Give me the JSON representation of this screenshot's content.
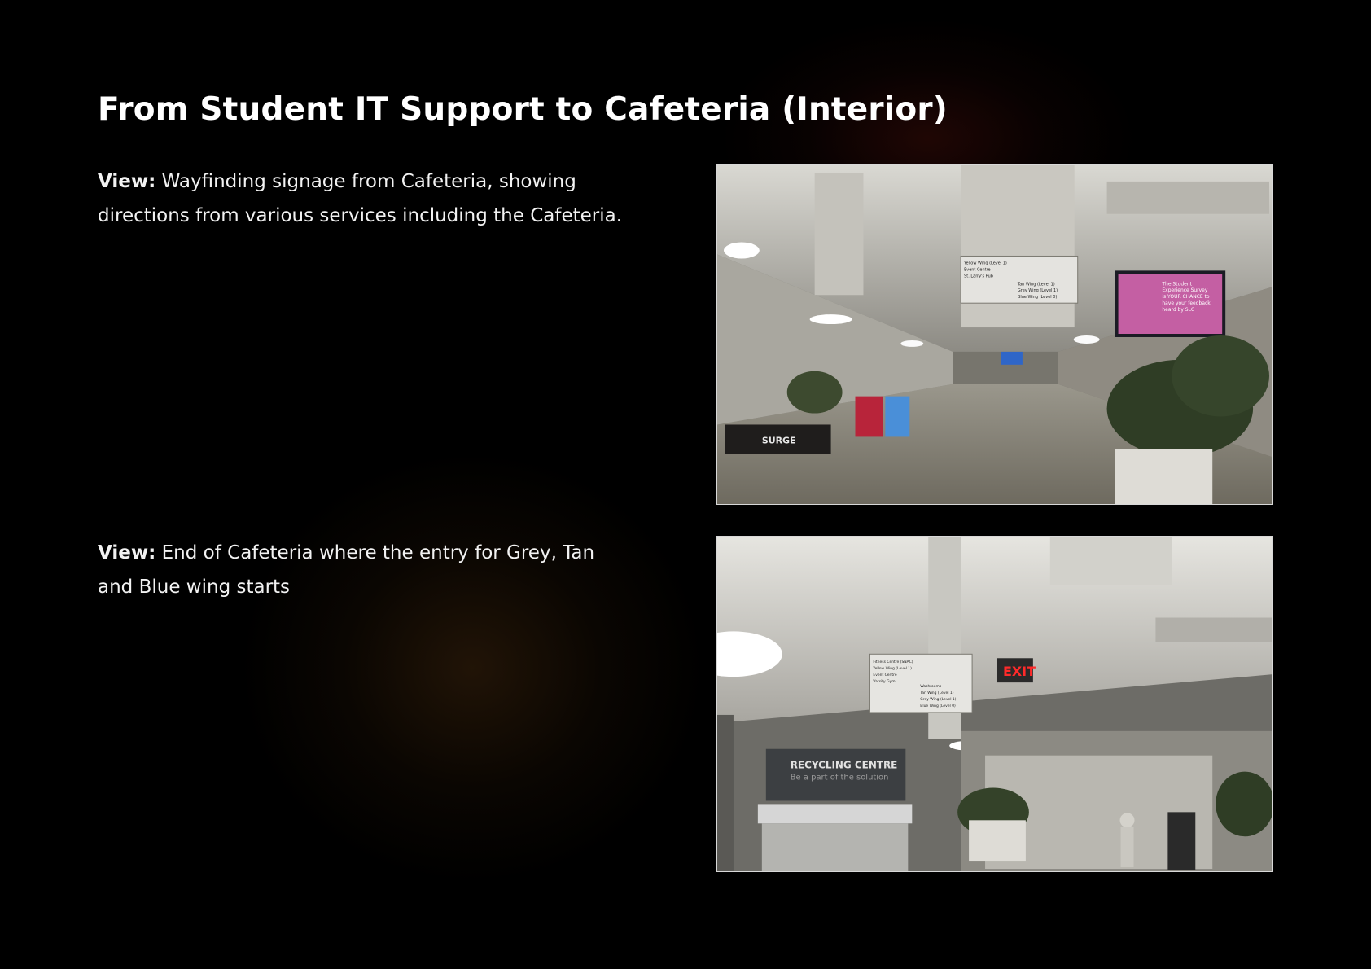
{
  "slide": {
    "title": "From Student IT Support to Cafeteria (Interior)"
  },
  "views": [
    {
      "label": "View:",
      "text": "Wayfinding signage from Cafeteria, showing directions from various services including the Cafeteria."
    },
    {
      "label": "View:",
      "text": "End of Cafeteria where the entry for Grey, Tan and Blue wing starts"
    }
  ],
  "photo1": {
    "sign_lines": [
      "Yellow Wing (Level 1)",
      "Event Centre",
      "St. Larry's Pub",
      "Tan Wing (Level 1)",
      "Grey Wing (Level 1)",
      "Blue Wing (Level 0)"
    ],
    "screen_lines": [
      "The Student",
      "Experience Survey",
      "is YOUR CHANCE to",
      "have your feedback",
      "heard by SLC"
    ],
    "counter_text": "SURGE"
  },
  "photo2": {
    "sign_lines": [
      "Fitness Centre (SNAC)",
      "Yellow Wing (Level 1)",
      "Event Centre",
      "Varsity Gym",
      "Washrooms",
      "Tan Wing (Level 1)",
      "Grey Wing (Level 1)",
      "Blue Wing (Level 0)"
    ],
    "exit_text": "EXIT",
    "recycling_title": "RECYCLING CENTRE",
    "recycling_sub": "Be a part of the solution"
  },
  "colors": {
    "background": "#000000",
    "text": "#ffffff",
    "glow_red": "#46100a",
    "glow_amber": "#3c240c",
    "exit_red": "#ff2a2a",
    "screen_pink": "#e0489a"
  }
}
